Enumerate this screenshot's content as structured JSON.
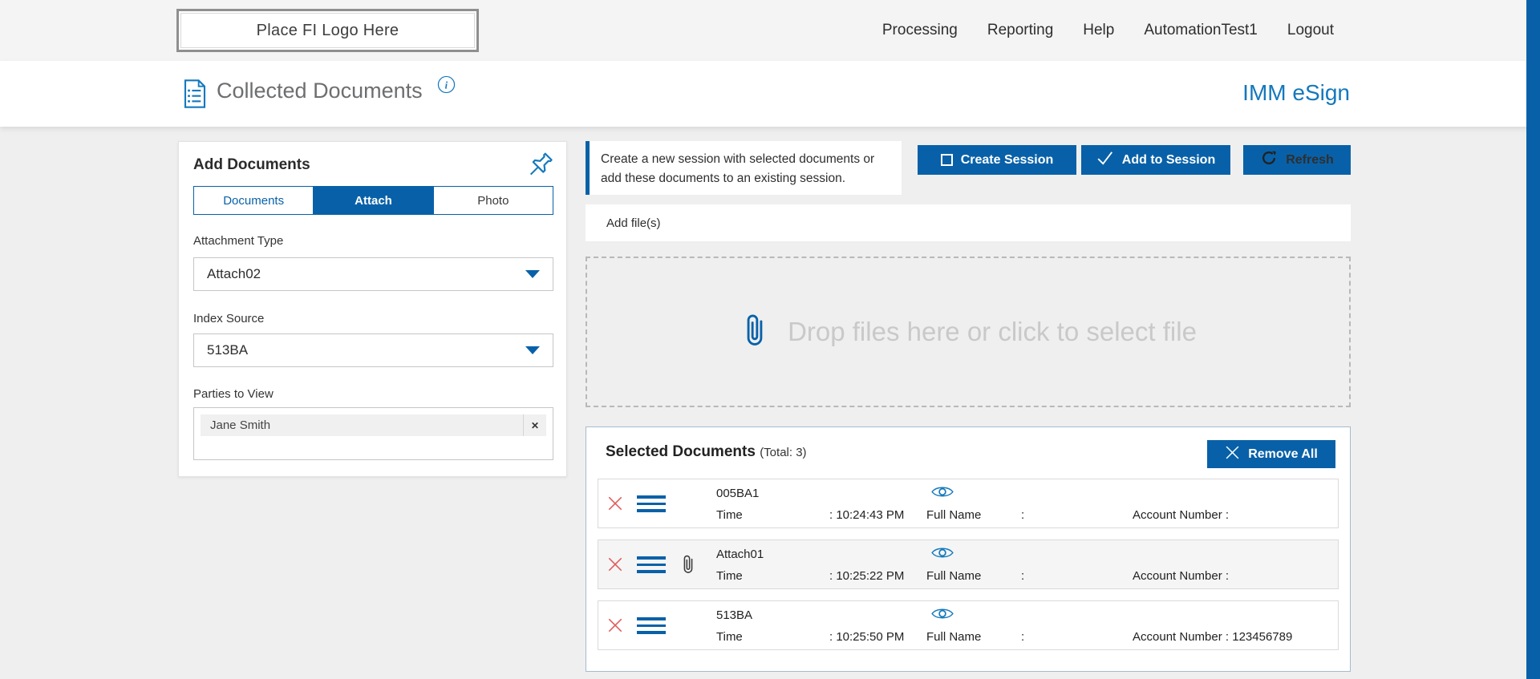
{
  "header": {
    "logo_text": "Place FI Logo Here",
    "nav": [
      "Processing",
      "Reporting",
      "Help",
      "AutomationTest1",
      "Logout"
    ]
  },
  "subheader": {
    "title": "Collected Documents",
    "brand": "IMM eSign"
  },
  "add_documents": {
    "title": "Add Documents",
    "tabs": [
      "Documents",
      "Attach",
      "Photo"
    ],
    "active_tab": "Attach",
    "attachment_type": {
      "label": "Attachment Type",
      "value": "Attach02"
    },
    "index_source": {
      "label": "Index Source",
      "value": "513BA"
    },
    "parties_to_view": {
      "label": "Parties to View",
      "selected_party": "Jane Smith",
      "remove_glyph": "✕"
    }
  },
  "session": {
    "message": "Create a new session with selected documents or add these documents to an existing session.",
    "create_button": "Create Session",
    "add_button": "Add to Session",
    "refresh_button": "Refresh"
  },
  "upload": {
    "add_files_label": "Add file(s)",
    "dropzone_text": "Drop files here or click to select file"
  },
  "selected_documents": {
    "title": "Selected Documents",
    "total_label": "(Total: 3)",
    "remove_all_label": "Remove All",
    "labels": {
      "time": "Time",
      "full_name": "Full Name",
      "account_number": "Account Number :"
    },
    "rows": [
      {
        "name": "005BA1",
        "has_attachment": false,
        "time_value": ": 10:24:43 PM",
        "full_name_value": ":",
        "account_value": ""
      },
      {
        "name": "Attach01",
        "has_attachment": true,
        "time_value": ": 10:25:22 PM",
        "full_name_value": ":",
        "account_value": ""
      },
      {
        "name": "513BA",
        "has_attachment": false,
        "time_value": ": 10:25:50 PM",
        "full_name_value": ":",
        "account_value": "123456789"
      }
    ]
  },
  "colors": {
    "primary_blue": "#0861a8",
    "brand_blue": "#1478bc",
    "icon_blue": "#1579bd",
    "remove_red": "#e05c5c"
  }
}
